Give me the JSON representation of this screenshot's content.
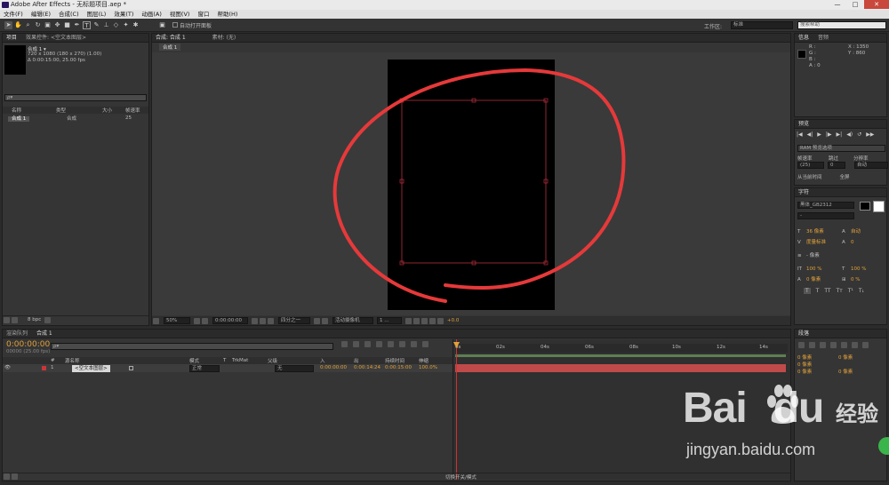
{
  "window": {
    "title": "Adobe After Effects - 无标题项目.aep *",
    "min": "—",
    "max": "□",
    "close": "✕"
  },
  "menu": [
    "文件(F)",
    "编辑(E)",
    "合成(C)",
    "图层(L)",
    "效果(T)",
    "动画(A)",
    "视图(V)",
    "窗口",
    "帮助(H)"
  ],
  "toolbar": {
    "auto_open": "自动打开面板",
    "workspace_label": "工作区:",
    "workspace_value": "标准",
    "search_placeholder": "搜索帮助"
  },
  "project": {
    "tabs": [
      "项目",
      "效果控件: <空文本图层>"
    ],
    "name": "合成 1 ▾",
    "line1": "720 x 1080 (180 x 270) (1.00)",
    "line2": "Δ 0:00:15:00, 25.00 fps",
    "search_placeholder": "ρ▾",
    "cols": [
      "名称",
      "类型",
      "大小",
      "帧速率"
    ],
    "item": {
      "name": "合成 1",
      "type": "合成",
      "fps": "25"
    },
    "bpc": "8 bpc"
  },
  "comp": {
    "tabs": [
      "合成: 合成 1",
      "素材: (无)"
    ],
    "subtab": "合成 1",
    "zoom": "50%",
    "time": "0:00:00:00",
    "res": "四分之一",
    "camera": "活动摄像机",
    "views": "1 ...",
    "exposure": "+0.0"
  },
  "info": {
    "tabs": [
      "信息",
      "音频"
    ],
    "r": "R :",
    "g": "G :",
    "b": "B :",
    "a": "A : 0",
    "x": "X : 1350",
    "y": "Y : 860"
  },
  "preview": {
    "tab": "预览",
    "ram": "RAM 预览选项",
    "fps_label": "帧速率",
    "skip_label": "跳过",
    "res_label": "分辨率",
    "fps": "(25)",
    "skip": "0",
    "res": "自动",
    "from_current": "从当前时间",
    "fullscreen": "全屏"
  },
  "character": {
    "tab": "字符",
    "font": "黑体_GB2312",
    "style": "-",
    "size": "36 像素",
    "leading": "自动",
    "kerning": "度量标准",
    "tracking": "0",
    "stroke": "- 像素",
    "vscale": "100 %",
    "hscale": "100 %",
    "baseline": "0 像素",
    "tsume": "0 %",
    "styles": [
      "T",
      "T",
      "TT",
      "Tт",
      "T¹",
      "T₁"
    ]
  },
  "paragraph": {
    "tab": "段落",
    "v1": "0 像素",
    "v2": "0 像素",
    "v3": "0 像素",
    "v4": "0 像素",
    "v5": "0 像素"
  },
  "timeline": {
    "tabs": [
      "渲染队列",
      "合成 1"
    ],
    "time": "0:00:00:00",
    "frames": "00000 (25.00 fps)",
    "search_placeholder": "ρ▾",
    "cols": [
      "#",
      "源名称",
      "模式",
      "T",
      "TrkMat",
      "父级",
      "入",
      "出",
      "持续时间",
      "伸缩"
    ],
    "layer": {
      "num": "1",
      "name": "<空文本图层>",
      "mode": "正常",
      "parent": "无",
      "in": "0:00:00:00",
      "out": "0:00:14:24",
      "dur": "0:00:15:00",
      "stretch": "100.0%"
    },
    "ruler": [
      "0s",
      "02s",
      "04s",
      "06s",
      "08s",
      "10s",
      "12s",
      "14s"
    ],
    "footer": "切换开关/模式"
  },
  "watermark": {
    "brand": "Bai",
    "brand2": "du",
    "cn": "经验",
    "url": "jingyan.baidu.com"
  },
  "colors": {
    "accent": "#e2a13a",
    "annot": "#e6393a",
    "bar": "#c04a4a"
  }
}
